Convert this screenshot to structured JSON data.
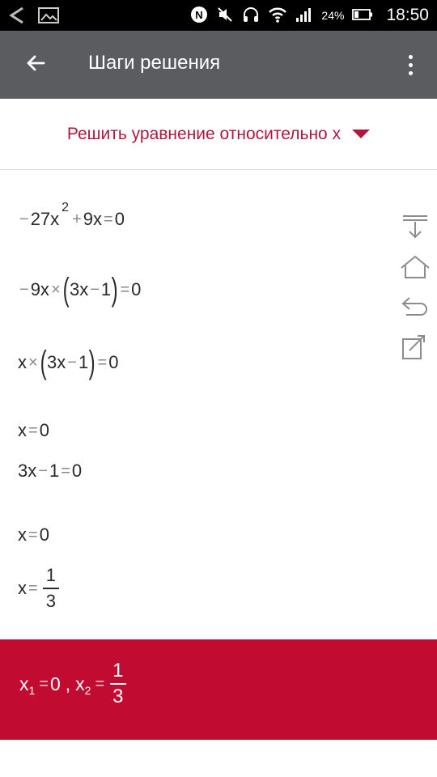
{
  "status_bar": {
    "battery": "24%",
    "time": "18:50"
  },
  "app_bar": {
    "title": "Шаги решения"
  },
  "selector": {
    "label": "Решить уравнение относительно x"
  },
  "steps": {
    "s1": {
      "a": "27x",
      "exp": "2",
      "b": "9x",
      "c": "0"
    },
    "s2": {
      "a": "9x",
      "b": "3x",
      "c": "1",
      "d": "0"
    },
    "s3": {
      "a": "x",
      "b": "3x",
      "c": "1",
      "d": "0"
    },
    "s4": {
      "a": "x",
      "b": "0"
    },
    "s5": {
      "a": "3x",
      "b": "1",
      "c": "0"
    },
    "s6": {
      "a": "x",
      "b": "0"
    },
    "s7": {
      "a": "x",
      "num": "1",
      "den": "3"
    }
  },
  "answer": {
    "x": "x",
    "i1": "1",
    "v1": "0",
    "sep": ",",
    "i2": "2",
    "num": "1",
    "den": "3"
  },
  "icons": [
    "nav-back-icon",
    "gallery-icon",
    "nfc-icon",
    "mute-icon",
    "headset-icon",
    "wifi-icon",
    "signal-icon",
    "battery-icon",
    "arrow-back-icon",
    "more-vert-icon",
    "dropdown-caret-icon",
    "download-icon",
    "home-icon",
    "undo-icon",
    "share-icon"
  ],
  "colors": {
    "accent": "#b0173e",
    "answer_bg": "#c10b30",
    "app_bar": "#5a5c60",
    "status_bar": "#000000"
  }
}
